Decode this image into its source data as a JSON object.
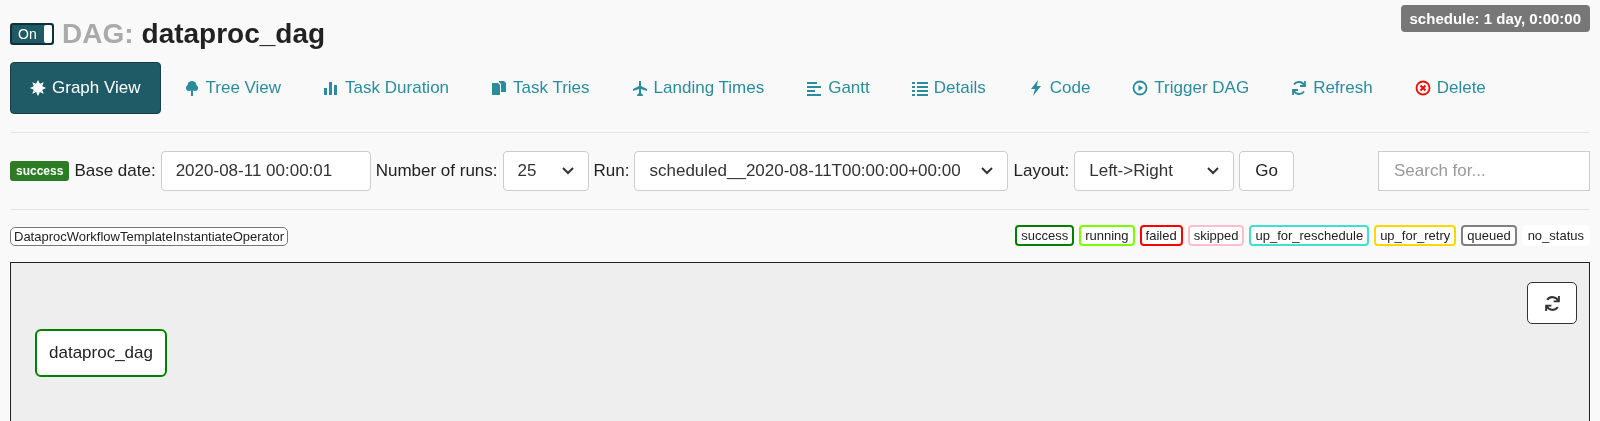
{
  "dag": {
    "toggle": {
      "label": "On",
      "on": true
    },
    "prefix": "DAG:",
    "name": "dataproc_dag",
    "schedule": "schedule: 1 day, 0:00:00"
  },
  "tabs": [
    {
      "label": "Graph View",
      "selected": true
    },
    {
      "label": "Tree View",
      "selected": false
    },
    {
      "label": "Task Duration",
      "selected": false
    },
    {
      "label": "Task Tries",
      "selected": false
    },
    {
      "label": "Landing Times",
      "selected": false
    },
    {
      "label": "Gantt",
      "selected": false
    },
    {
      "label": "Details",
      "selected": false
    },
    {
      "label": "Code",
      "selected": false
    },
    {
      "label": "Trigger DAG",
      "selected": false
    },
    {
      "label": "Refresh",
      "selected": false
    },
    {
      "label": "Delete",
      "selected": false
    }
  ],
  "form": {
    "state_badge": "success",
    "base_date_label": "Base date:",
    "base_date": "2020-08-11 00:00:01",
    "runs_label": "Number of runs:",
    "runs": "25",
    "run_label": "Run:",
    "run": "scheduled__2020-08-11T00:00:00+00:00",
    "layout_label": "Layout:",
    "layout": "Left->Right",
    "go": "Go",
    "search": {
      "placeholder": "Search for..."
    }
  },
  "operators": [
    {
      "label": "DataprocWorkflowTemplateInstantiateOperator"
    }
  ],
  "legend": [
    {
      "label": "success",
      "color": "#008000"
    },
    {
      "label": "running",
      "color": "#7cfc00"
    },
    {
      "label": "failed",
      "color": "#ff0000"
    },
    {
      "label": "skipped",
      "color": "#ffc0cb"
    },
    {
      "label": "up_for_reschedule",
      "color": "#40e0d0"
    },
    {
      "label": "up_for_retry",
      "color": "#ffd700"
    },
    {
      "label": "queued",
      "color": "#808080"
    },
    {
      "label": "no_status",
      "color": "#ffffff"
    }
  ],
  "graph": {
    "nodes": [
      {
        "label": "dataproc_dag",
        "color": "#008000"
      }
    ]
  }
}
